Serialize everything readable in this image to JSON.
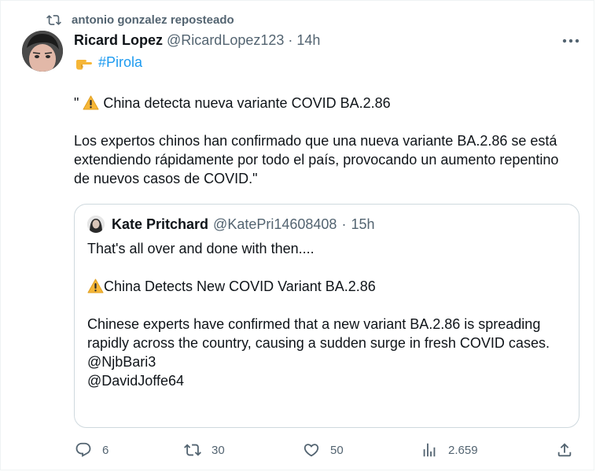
{
  "repost": {
    "text": "antonio gonzalez reposteado"
  },
  "tweet": {
    "author_name": "Ricard Lopez",
    "author_handle": "@RicardLopez123",
    "separator": "·",
    "time": "14h",
    "hashtag": "#Pirola",
    "quote_open": "\"",
    "headline": " China detecta nueva variante COVID BA.2.86",
    "paragraph": " Los expertos chinos han confirmado que una nueva variante BA.2.86 se está extendiendo rápidamente por todo el país, provocando un aumento repentino de nuevos casos de COVID.\""
  },
  "quoted": {
    "author_name": "Kate Pritchard",
    "author_handle": "@KatePri14608408",
    "separator": "·",
    "time": "15h",
    "line1": "That's all over and done with then....",
    "headline": "China Detects New COVID Variant BA.2.86",
    "paragraph": "Chinese experts have confirmed that a new variant BA.2.86 is spreading rapidly across the country, causing a sudden surge in fresh COVID cases.",
    "mention1": "@NjbBari3",
    "mention2": "@DavidJoffe64"
  },
  "actions": {
    "replies": "6",
    "reposts": "30",
    "likes": "50",
    "views": "2.659"
  },
  "colors": {
    "text": "#0f1419",
    "secondary": "#536471",
    "link": "#1d9bf0",
    "border": "#cfd9de"
  },
  "icons": [
    "repost-icon",
    "more-icon",
    "pointing-hand-emoji",
    "warning-emoji",
    "reply-icon",
    "like-icon",
    "views-icon",
    "share-icon"
  ]
}
